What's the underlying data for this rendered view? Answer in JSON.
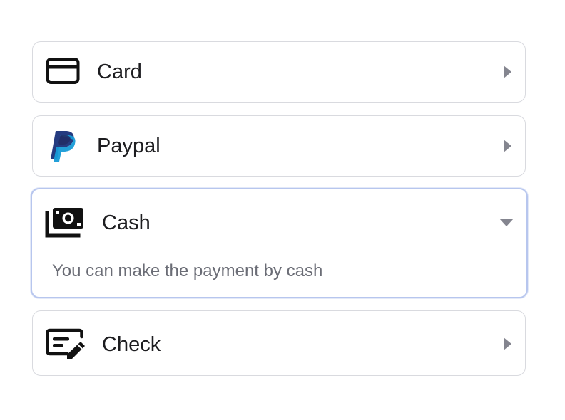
{
  "payment_options": [
    {
      "label": "Card",
      "icon": "credit-card-icon",
      "expanded": false
    },
    {
      "label": "Paypal",
      "icon": "paypal-icon",
      "expanded": false
    },
    {
      "label": "Cash",
      "icon": "cash-icon",
      "expanded": true,
      "description": "You can make the payment by cash"
    },
    {
      "label": "Check",
      "icon": "check-icon",
      "expanded": false
    }
  ],
  "colors": {
    "border": "#d9dadf",
    "focus_border": "#b7c6ee",
    "text": "#1d1d20",
    "muted_text": "#6b6d76",
    "chevron": "#84858f",
    "paypal_dark": "#253b80",
    "paypal_light": "#179bd7"
  }
}
